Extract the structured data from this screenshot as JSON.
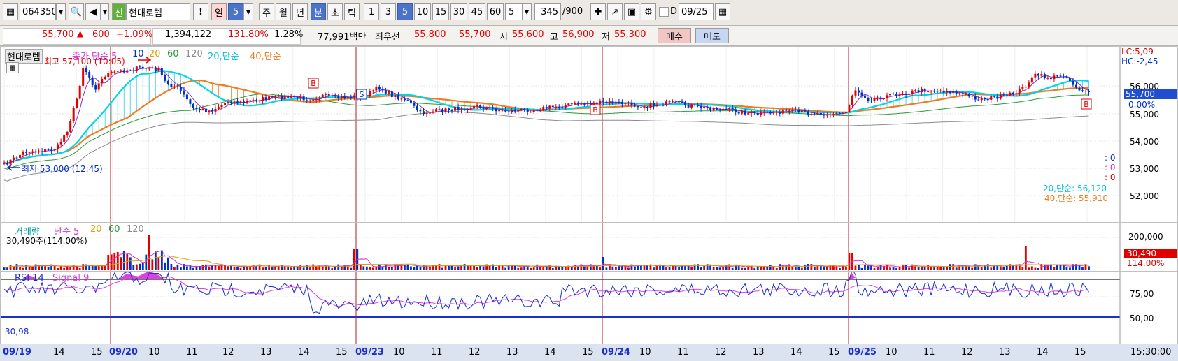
{
  "toolbar": {
    "code": "064350",
    "badge": "신",
    "name": "현대로템",
    "alert": "!",
    "period_day": "일",
    "period_num": "5",
    "week": "주",
    "month": "월",
    "year": "년",
    "minute": "분",
    "second": "초",
    "tick": "틱",
    "intervals": [
      "1",
      "3",
      "5",
      "10",
      "15",
      "30",
      "45",
      "60"
    ],
    "active_interval": "5",
    "count_select": "5",
    "count": "345",
    "max_count": "/900",
    "d_label": "D",
    "date": "09/25"
  },
  "info": {
    "price": "55,700",
    "change": "600",
    "pct": "+1.09%",
    "volume": "1,394,122",
    "vol_ratio": "131.80%",
    "turnover": "1.28%",
    "amount": "77,991백만",
    "best_label": "최우선",
    "ask": "55,800",
    "bid": "55,700",
    "open_label": "시",
    "open": "55,600",
    "high_label": "고",
    "high": "56,900",
    "low_label": "저",
    "low": "55,300",
    "buy": "매수",
    "sell": "매도"
  },
  "price_panel": {
    "stock": "현대로템",
    "legend": [
      "종가 단순 5",
      "10",
      "20",
      "60",
      "120",
      "20,단순",
      "40,단순"
    ],
    "high_note": "최고 57,100 (10:05)",
    "low_note": "최저 53,000 (12:45)",
    "lc": "LC:5,09",
    "hc": "HC:-2,45",
    "price_tag": "55,700",
    "pct_tag": "0.00%",
    "yticks": [
      "56,000",
      "55,000",
      "54,000",
      "53,000",
      "52,000"
    ],
    "zeros": [
      ": 0",
      ": 0",
      ": 0"
    ],
    "ma20_value": "20,단순: 56,120",
    "ma40_value": "40,단순: 55,910",
    "markers": [
      "B",
      "S",
      "B",
      "B"
    ]
  },
  "volume_panel": {
    "legend": [
      "거래량",
      "단순 5",
      "20",
      "60",
      "120"
    ],
    "vol_text": "30,490주(114.00%)",
    "tick": "200,000",
    "tag": "30,490",
    "pct_tag": "114.00%"
  },
  "rsi_panel": {
    "legend": [
      "RSI 14",
      "Signal 9"
    ],
    "value": "30,98",
    "ticks": [
      "75,00",
      "50,00"
    ]
  },
  "xaxis": {
    "labels": [
      "09/19",
      "14",
      "15",
      "09/20",
      "10",
      "11",
      "12",
      "13",
      "14",
      "15",
      "09/23",
      "10",
      "11",
      "12",
      "13",
      "14",
      "15",
      "09/24",
      "10",
      "11",
      "12",
      "13",
      "14",
      "15",
      "09/25",
      "10",
      "11",
      "12",
      "13",
      "14",
      "15"
    ],
    "time": "15:30:00"
  },
  "colors": {
    "up": "#e00000",
    "down": "#0030c8",
    "ma20": "#00d5e8",
    "ma40": "#ee7c1e",
    "ma60": "#2a9a3a",
    "ma120": "#8c8c8c",
    "rsi": "#1a2fd0",
    "signal": "#e040e0"
  }
}
